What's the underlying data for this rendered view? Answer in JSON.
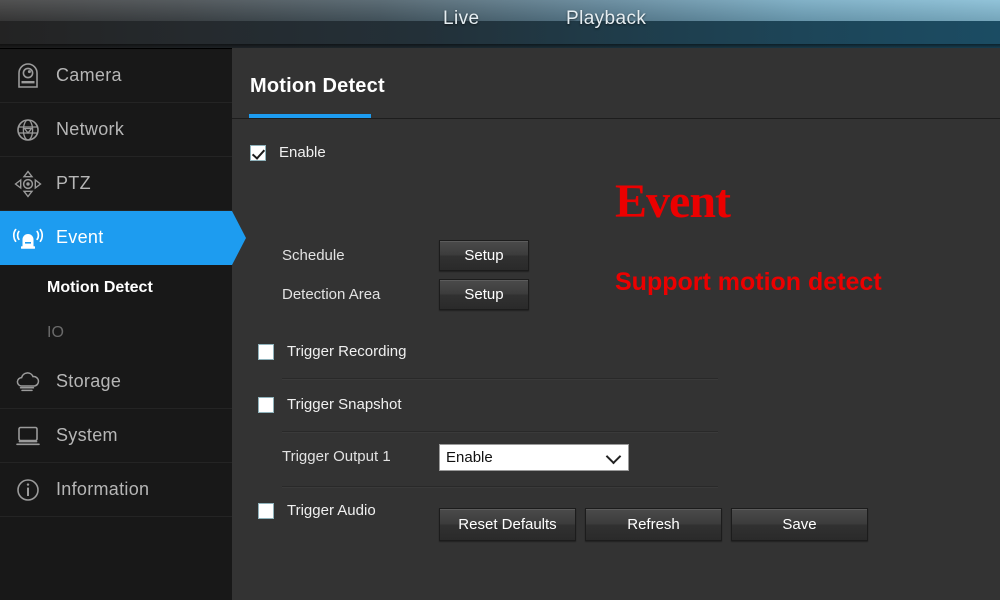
{
  "topbar": {
    "tabs": [
      {
        "label": "Live",
        "name": "tab-live"
      },
      {
        "label": "Playback",
        "name": "tab-playback"
      }
    ]
  },
  "sidebar": {
    "items": [
      {
        "label": "Camera",
        "icon": "camera-icon",
        "active": false
      },
      {
        "label": "Network",
        "icon": "globe-network-icon",
        "active": false
      },
      {
        "label": "PTZ",
        "icon": "ptz-dpad-icon",
        "active": false
      },
      {
        "label": "Event",
        "icon": "alarm-siren-icon",
        "active": true
      },
      {
        "label": "Storage",
        "icon": "cloud-storage-icon",
        "active": false
      },
      {
        "label": "System",
        "icon": "monitor-icon",
        "active": false
      },
      {
        "label": "Information",
        "icon": "info-circle-icon",
        "active": false
      }
    ],
    "sub_items": [
      {
        "label": "Motion Detect",
        "active": true
      },
      {
        "label": "IO",
        "active": false
      }
    ]
  },
  "main": {
    "title": "Motion Detect",
    "enable": {
      "label": "Enable",
      "checked": true
    },
    "schedule": {
      "label": "Schedule",
      "button": "Setup"
    },
    "detection_area": {
      "label": "Detection Area",
      "button": "Setup"
    },
    "trigger_recording": {
      "label": "Trigger Recording",
      "checked": false
    },
    "trigger_snapshot": {
      "label": "Trigger Snapshot",
      "checked": false
    },
    "trigger_output_1": {
      "label": "Trigger Output 1",
      "value": "Enable"
    },
    "trigger_audio": {
      "label": "Trigger Audio",
      "checked": false
    },
    "actions": {
      "reset": "Reset Defaults",
      "refresh": "Refresh",
      "save": "Save"
    }
  },
  "annotations": {
    "heading": "Event",
    "subtext": "Support motion detect",
    "color": "#ec0000"
  },
  "colors": {
    "accent": "#1d9cf0",
    "content_bg": "#333333",
    "sidebar_bg": "#181818"
  }
}
